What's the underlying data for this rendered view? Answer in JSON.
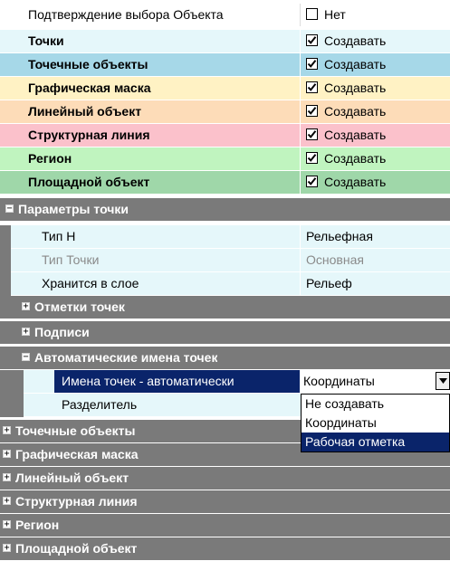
{
  "rows": {
    "confirm": {
      "label": "Подтверждение выбора Объекта",
      "value": "Нет"
    },
    "points": {
      "label": "Точки",
      "value": "Создавать"
    },
    "point_objects": {
      "label": "Точечные объекты",
      "value": "Создавать"
    },
    "graphic_mask": {
      "label": "Графическая маска",
      "value": "Создавать"
    },
    "linear_object": {
      "label": "Линейный объект",
      "value": "Создавать"
    },
    "structural_line": {
      "label": "Структурная линия",
      "value": "Создавать"
    },
    "region": {
      "label": "Регион",
      "value": "Создавать"
    },
    "area_object": {
      "label": "Площадной объект",
      "value": "Создавать"
    }
  },
  "point_params": {
    "title": "Параметры точки",
    "type_h": {
      "label": "Тип Н",
      "value": "Рельефная"
    },
    "point_type": {
      "label": "Тип Точки",
      "value": "Основная"
    },
    "stored_in_layer": {
      "label": "Хранится в слое",
      "value": "Рельеф"
    },
    "point_marks": "Отметки точек",
    "captions": "Подписи",
    "auto_names": {
      "title": "Автоматические имена точек",
      "names_auto": {
        "label": "Имена точек - автоматически",
        "value": "Координаты"
      },
      "separator": {
        "label": "Разделитель"
      }
    }
  },
  "dropdown": {
    "options": [
      "Не создавать",
      "Координаты",
      "Рабочая отметка"
    ],
    "highlighted": "Рабочая отметка"
  },
  "categories": {
    "point_objects": "Точечные объекты",
    "graphic_mask": "Графическая маска",
    "linear_object": "Линейный объект",
    "structural_line": "Структурная линия",
    "region": "Регион",
    "area_object": "Площадной объект"
  },
  "colors": {
    "points": "#e5f7fa",
    "point_objects": "#a6d8e8",
    "graphic_mask": "#fff2c4",
    "linear_object": "#fddcb8",
    "structural_line": "#fbc1cb",
    "region": "#c0f4bf",
    "area_object": "#9fd7a9",
    "category": "#7a7a7a",
    "selection": "#0a246a"
  },
  "icons": {
    "expanded": "−",
    "collapsed": "+",
    "dropdown": "chevron-down-icon",
    "checkbox": "check-icon"
  }
}
